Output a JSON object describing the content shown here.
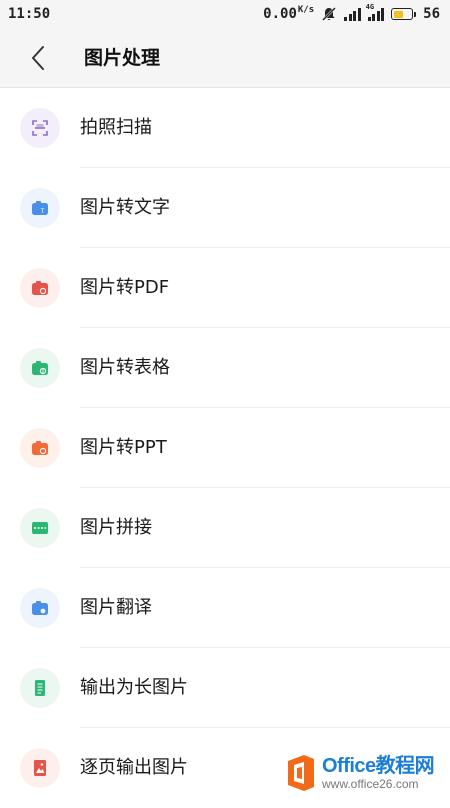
{
  "status_bar": {
    "time": "11:50",
    "net_speed": "0.00",
    "net_unit": "K/s",
    "network_type": "4G",
    "battery_level": "56",
    "battery_fraction": 0.56
  },
  "header": {
    "back_icon": "chevron-left-icon",
    "title": "图片处理"
  },
  "items": [
    {
      "label": "拍照扫描",
      "icon": "scan-icon",
      "color": "#8a6cc9",
      "bg": "#f2eefa"
    },
    {
      "label": "图片转文字",
      "icon": "image-to-text-icon",
      "color": "#4a8fe7",
      "bg": "#eef4fd"
    },
    {
      "label": "图片转PDF",
      "icon": "image-to-pdf-icon",
      "color": "#e5534b",
      "bg": "#fdefee"
    },
    {
      "label": "图片转表格",
      "icon": "image-to-table-icon",
      "color": "#2bb673",
      "bg": "#ebf8f1"
    },
    {
      "label": "图片转PPT",
      "icon": "image-to-ppt-icon",
      "color": "#f06a3a",
      "bg": "#fef0ea"
    },
    {
      "label": "图片拼接",
      "icon": "image-stitch-icon",
      "color": "#2bb673",
      "bg": "#ebf8f1"
    },
    {
      "label": "图片翻译",
      "icon": "image-translate-icon",
      "color": "#4a8fe7",
      "bg": "#eef4fd"
    },
    {
      "label": "输出为长图片",
      "icon": "long-image-icon",
      "color": "#2bb673",
      "bg": "#ebf8f1"
    },
    {
      "label": "逐页输出图片",
      "icon": "page-image-icon",
      "color": "#e5534b",
      "bg": "#fdefee"
    }
  ],
  "watermark": {
    "brand": "Office教程网",
    "url": "www.office26.com"
  },
  "colors": {
    "header_bg": "#f5f5f5",
    "watermark_orange": "#f06a1a",
    "watermark_blue": "#1b7fd6"
  }
}
